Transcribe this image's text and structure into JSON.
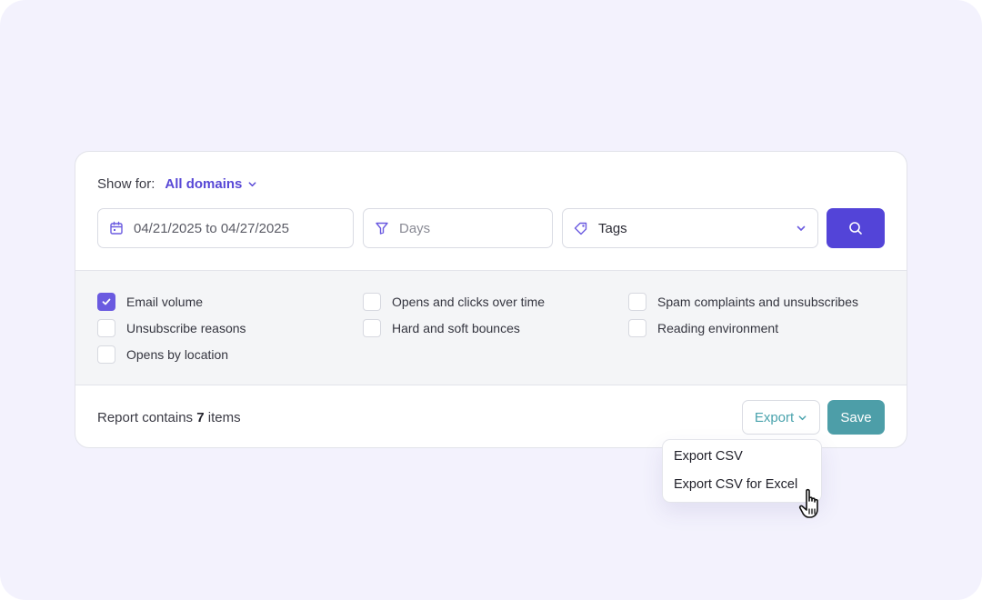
{
  "filter": {
    "show_for_label": "Show for:",
    "domain_value": "All domains",
    "date_range": "04/21/2025 to 04/27/2025",
    "days_placeholder": "Days",
    "tags_label": "Tags"
  },
  "report_options": [
    {
      "label": "Email volume",
      "checked": true
    },
    {
      "label": "Opens and clicks over time",
      "checked": false
    },
    {
      "label": "Spam complaints and unsubscribes",
      "checked": false
    },
    {
      "label": "Unsubscribe reasons",
      "checked": false
    },
    {
      "label": "Hard and soft bounces",
      "checked": false
    },
    {
      "label": "Reading environment",
      "checked": false
    },
    {
      "label": "Opens by location",
      "checked": false
    }
  ],
  "footer": {
    "report_prefix": "Report contains",
    "item_count": "7",
    "report_suffix": "items",
    "export_label": "Export",
    "save_label": "Save"
  },
  "export_menu": {
    "items": [
      "Export CSV",
      "Export CSV for Excel"
    ]
  },
  "icons": {
    "calendar": "calendar-icon",
    "filter": "filter-icon",
    "tag": "tag-icon",
    "search": "search-icon",
    "chevron": "chevron-down-icon",
    "check": "check-icon",
    "cursor": "hand-pointer-icon"
  },
  "colors": {
    "accent": "#5344d8",
    "checkbox": "#6a5ae0",
    "teal": "#4d9ea8",
    "page_bg": "#f3f2fd"
  }
}
